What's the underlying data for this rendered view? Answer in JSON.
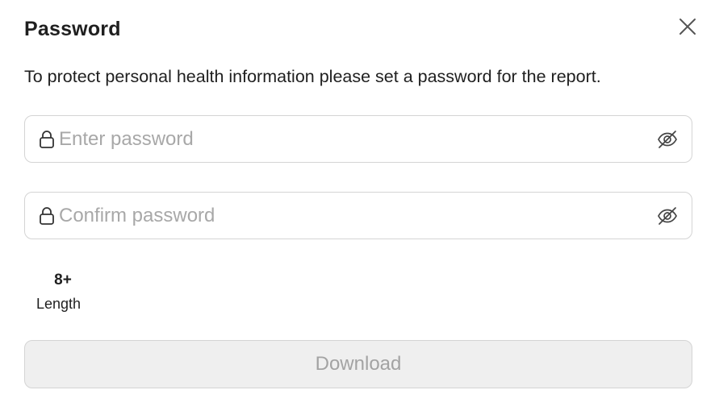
{
  "dialog": {
    "title": "Password",
    "description": "To protect personal health information please set a password for the report."
  },
  "fields": {
    "password": {
      "value": "",
      "placeholder": "Enter password"
    },
    "confirm": {
      "value": "",
      "placeholder": "Confirm password"
    }
  },
  "requirements": [
    {
      "value": "8+",
      "label": "Length"
    }
  ],
  "actions": {
    "download_label": "Download",
    "download_enabled": false
  },
  "icons": {
    "close": "close-icon",
    "lock": "lock-icon",
    "eye": "eye-off-icon"
  },
  "colors": {
    "text": "#1f1f1f",
    "placeholder": "#a8a8a8",
    "border": "#d4d4d4",
    "disabled_bg": "#efefef",
    "disabled_text": "#a3a3a3"
  }
}
